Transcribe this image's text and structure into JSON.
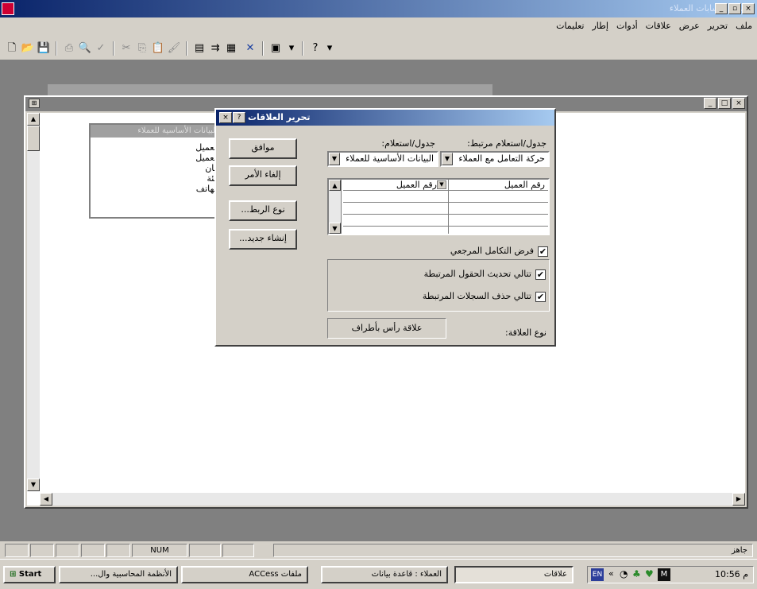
{
  "app": {
    "title": "برنامج حسابات العملاء",
    "min": "_",
    "max": "▫",
    "close": "×"
  },
  "menu": [
    "ملف",
    "تحرير",
    "عرض",
    "علاقات",
    "أدوات",
    "إطار",
    "تعليمات"
  ],
  "toolbar": [
    "new-icon",
    "open-icon",
    "save-icon",
    "print-icon",
    "preview-icon",
    "spell-icon",
    "cut-icon",
    "copy-icon",
    "paste-icon",
    "format-painter-icon",
    "show-table-icon",
    "show-direct-icon",
    "show-all-icon",
    "delete-icon",
    "new-object-icon",
    "help-icon"
  ],
  "table_box": {
    "title": "البيانات الأساسية للعملاء",
    "fields": [
      "العميل",
      "العميل",
      "بيان",
      "بيئة",
      "الهاتف"
    ]
  },
  "dialog": {
    "title": "تحرير العلاقات",
    "help": "?",
    "close": "×",
    "label_table": "جدول/استعلام مرتبط:",
    "label_related": "جدول/استعلام:",
    "table_value": "حركة التعامل مع العملاء",
    "related_value": "البيانات الأساسية للعملاء",
    "field_left": "رقم العميل",
    "field_right": "رقم العميل",
    "btn_ok": "موافق",
    "btn_cancel": "إلغاء الأمر",
    "btn_jointype": "نوع الربط...",
    "btn_createnew": "إنشاء جديد...",
    "chk_integrity": "فرض التكامل المرجعي",
    "chk_update": "تتالي تحديث الحقول المرتبطة",
    "chk_delete": "تتالي حذف السجلات المرتبطة",
    "rel_type_label": "نوع العلاقة:",
    "rel_type_value": "علاقة رأس بأطراف"
  },
  "status": {
    "num": "NUM",
    "ready": "جاهز"
  },
  "taskbar": {
    "start": "Start",
    "tasks": [
      "الأنظمة المحاسبية وال...",
      "ملفات ACCess",
      "العملاء : قاعدة بيانات",
      "علاقات"
    ],
    "clock": "10:56 م",
    "lang": "EN"
  }
}
